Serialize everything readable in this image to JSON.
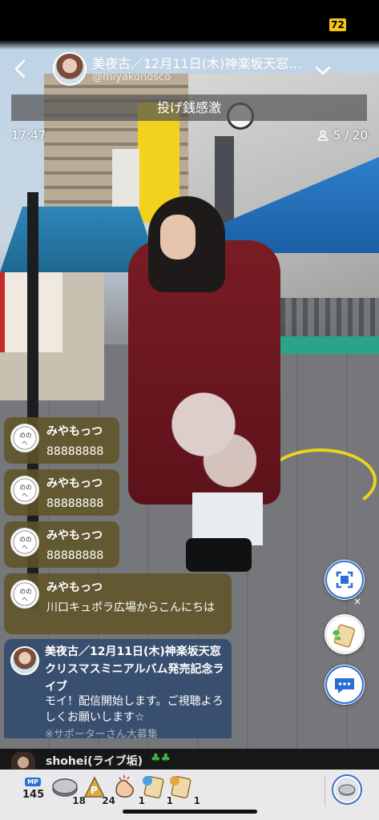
{
  "status_bar": {
    "battery": "72"
  },
  "header": {
    "title": "美夜古／12月11日(木)神楽坂天窓…",
    "handle": "@miyakonosco"
  },
  "banner": {
    "text": "投げ銭感激"
  },
  "stream_info": {
    "elapsed_time": "17:47",
    "viewers": "5 / 20"
  },
  "chat": {
    "messages": [
      {
        "name": "みやもっつ",
        "text": "88888888"
      },
      {
        "name": "みやもっつ",
        "text": "88888888"
      },
      {
        "name": "みやもっつ",
        "text": "88888888"
      },
      {
        "name": "みやもっつ",
        "text": "川口キュポラ広場からこんにちは"
      }
    ],
    "host_card": {
      "title": "美夜古／12月11日(木)神楽坂天窓クリスマスミニアルバム発売記念ライブ",
      "message": "モイ！配信開始します。ご視聴よろしくお願いします☆",
      "message_faded": "※サポーターさん大募集"
    }
  },
  "latest_comment": {
    "name": "shohei(ライブ垢)",
    "badges": "♣♣"
  },
  "side_buttons": {
    "items": [
      "capture-icon",
      "sticker-icon",
      "comment-icon"
    ],
    "sticker_close": "×"
  },
  "bottom_tray": {
    "mp": {
      "label": "MP",
      "value": "145"
    },
    "items": [
      {
        "icon": "coin-icon",
        "count": "18"
      },
      {
        "icon": "p-badge-icon",
        "count": "24"
      },
      {
        "icon": "clap-icon",
        "count": "1"
      },
      {
        "icon": "badge-icon",
        "count": "1"
      },
      {
        "icon": "badge-icon",
        "count": "1"
      }
    ],
    "gift_icon": "gift-coin-icon"
  },
  "colors": {
    "battery_badge": "#f5c518",
    "chat_bubble": "#605428",
    "host_card": "#30486e",
    "accent_blue": "#2a6fd6",
    "tray": "#e9e9ec"
  }
}
